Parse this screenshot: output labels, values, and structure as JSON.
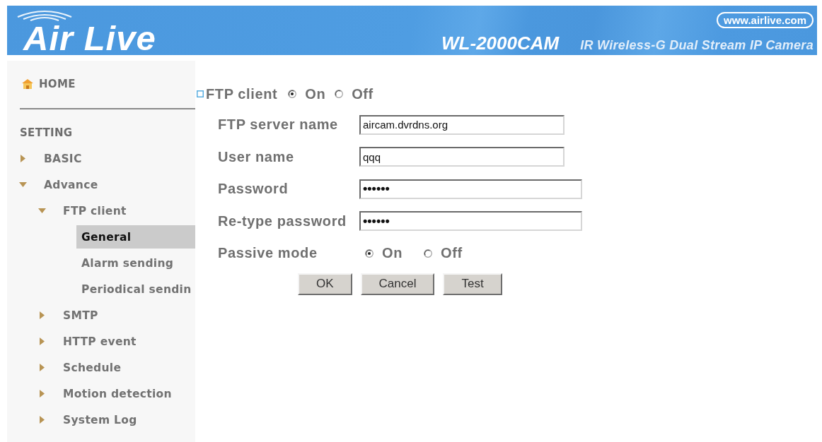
{
  "header": {
    "logo": "Air Live",
    "website": "www.airlive.com",
    "model": "WL-2000CAM",
    "description": "IR Wireless-G Dual Stream IP Camera"
  },
  "sidebar": {
    "home": "HOME",
    "section": "SETTING",
    "items": [
      {
        "label": "BASIC",
        "expanded": false,
        "selected": false
      },
      {
        "label": "Advance",
        "expanded": true,
        "selected": false,
        "children": [
          {
            "label": "FTP client",
            "expanded": true,
            "selected": false,
            "children": [
              {
                "label": "General",
                "selected": true
              },
              {
                "label": "Alarm sending",
                "selected": false
              },
              {
                "label": "Periodical sendin",
                "selected": false
              }
            ]
          },
          {
            "label": "SMTP",
            "expanded": false,
            "selected": false
          },
          {
            "label": "HTTP event",
            "expanded": false,
            "selected": false
          },
          {
            "label": "Schedule",
            "expanded": false,
            "selected": false
          },
          {
            "label": "Motion detection",
            "expanded": false,
            "selected": false
          },
          {
            "label": "System Log",
            "expanded": false,
            "selected": false
          }
        ]
      }
    ]
  },
  "form": {
    "title": "FTP client",
    "enable": [
      {
        "label": "On",
        "selected": true
      },
      {
        "label": "Off",
        "selected": false
      }
    ],
    "fields": [
      {
        "label": "FTP server name",
        "kind": "text",
        "value": "aircam.dvrdns.org"
      },
      {
        "label": "User name",
        "kind": "text",
        "value": "qqq"
      },
      {
        "label": "Password",
        "kind": "password",
        "value": "••••••"
      },
      {
        "label": "Re-type password",
        "kind": "password",
        "value": "••••••"
      },
      {
        "label": "Passive mode",
        "kind": "radio",
        "options": [
          {
            "label": "On",
            "selected": true
          },
          {
            "label": "Off",
            "selected": false
          }
        ]
      }
    ],
    "buttons": [
      "OK",
      "Cancel",
      "Test"
    ]
  }
}
